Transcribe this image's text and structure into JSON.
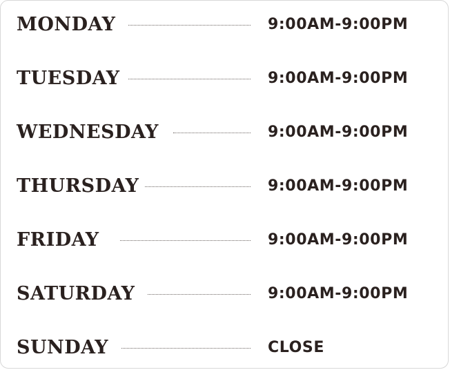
{
  "schedule": {
    "days": [
      {
        "day": "MONDAY",
        "hours": "9:00AM-9:00PM"
      },
      {
        "day": "TUESDAY",
        "hours": "9:00AM-9:00PM"
      },
      {
        "day": "WEDNESDAY",
        "hours": "9:00AM-9:00PM"
      },
      {
        "day": "THURSDAY",
        "hours": "9:00AM-9:00PM"
      },
      {
        "day": "FRIDAY",
        "hours": "9:00AM-9:00PM"
      },
      {
        "day": "SATURDAY",
        "hours": "9:00AM-9:00PM"
      },
      {
        "day": "SUNDAY",
        "hours": "CLOSE"
      }
    ]
  }
}
